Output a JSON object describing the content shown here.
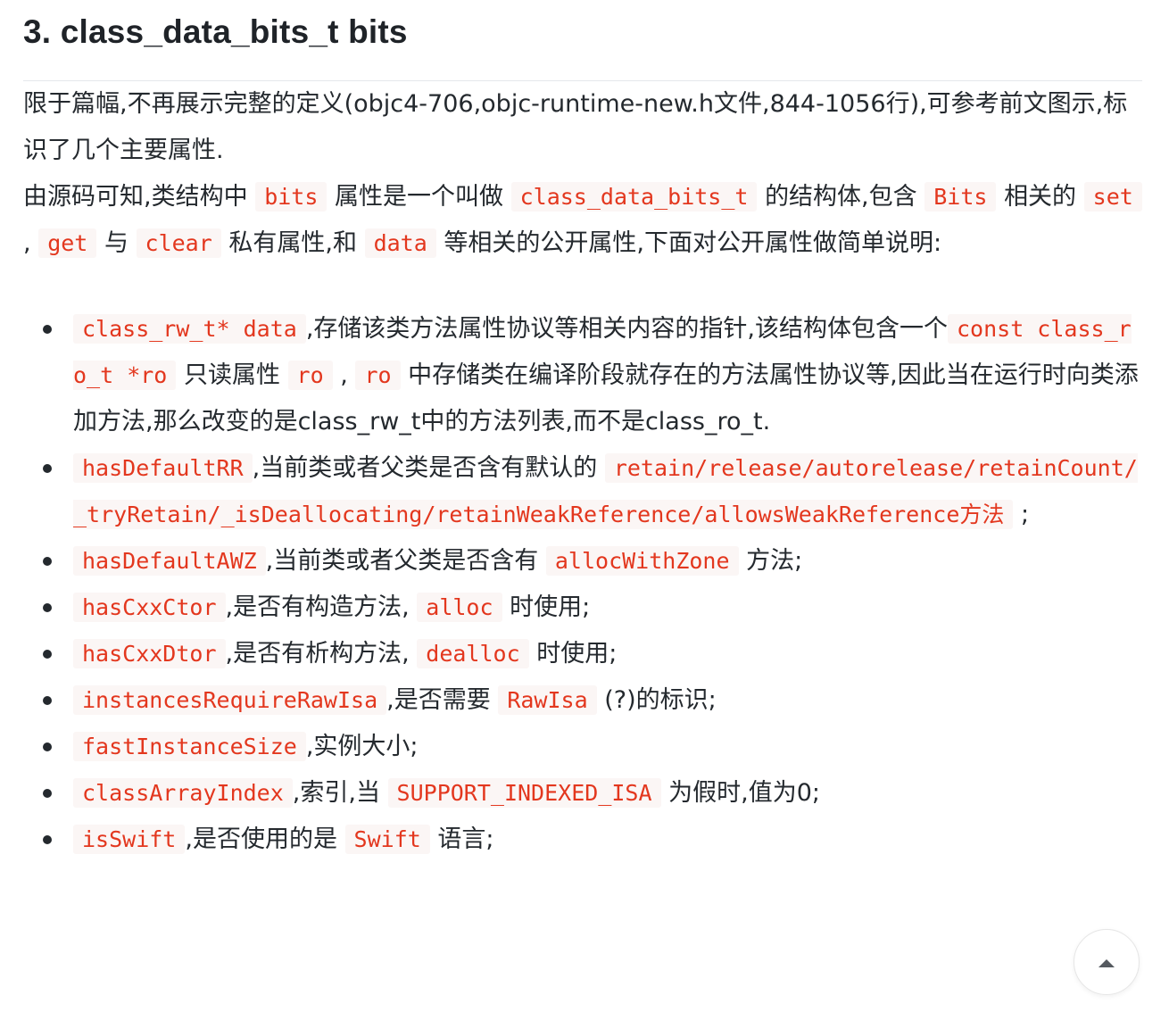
{
  "heading": "3. class_data_bits_t bits",
  "para1": "限于篇幅,不再展示完整的定义(objc4-706,objc-runtime-new.h文件,844-1056行),可参考前文图示,标识了几个主要属性.",
  "para2": {
    "t1": "由源码可知,类结构中",
    "c1": "bits",
    "t2": "属性是一个叫做",
    "c2": "class_data_bits_t",
    "t3": "的结构体,包含",
    "c3": "Bits",
    "t4": "相关的",
    "c4": "set",
    "t5": ",",
    "c5": "get",
    "t6": "与",
    "c6": "clear",
    "t7": "私有属性,和",
    "c7": "data",
    "t8": "等相关的公开属性,下面对公开属性做简单说明:"
  },
  "items": [
    {
      "c1": "class_rw_t* data",
      "t1": ",存储该类方法属性协议等相关内容的指针,该结构体包含一个",
      "c2": "const class_ro_t *ro",
      "t2": "只读属性",
      "c3": "ro",
      "t3": ",",
      "c4": "ro",
      "t4": "中存储类在编译阶段就存在的方法属性协议等,因此当在运行时向类添加方法,那么改变的是class_rw_t中的方法列表,而不是class_ro_t."
    },
    {
      "c1": "hasDefaultRR",
      "t1": ",当前类或者父类是否含有默认的",
      "c2": "retain/release/autorelease/retainCount/_tryRetain/_isDeallocating/retainWeakReference/allowsWeakReference方法",
      "t2": ";"
    },
    {
      "c1": "hasDefaultAWZ",
      "t1": ",当前类或者父类是否含有",
      "c2": "allocWithZone",
      "t2": "方法;"
    },
    {
      "c1": "hasCxxCtor",
      "t1": ",是否有构造方法,",
      "c2": "alloc",
      "t2": "时使用;"
    },
    {
      "c1": "hasCxxDtor",
      "t1": ",是否有析构方法,",
      "c2": "dealloc",
      "t2": "时使用;"
    },
    {
      "c1": "instancesRequireRawIsa",
      "t1": ",是否需要",
      "c2": "RawIsa",
      "t2": "(?)的标识;"
    },
    {
      "c1": "fastInstanceSize",
      "t1": ",实例大小;"
    },
    {
      "c1": "classArrayIndex",
      "t1": ",索引,当",
      "c2": "SUPPORT_INDEXED_ISA",
      "t2": "为假时,值为0;"
    },
    {
      "c1": "isSwift",
      "t1": ",是否使用的是",
      "c2": "Swift",
      "t2": "语言;"
    }
  ],
  "back_to_top_icon": "chevron-up-icon",
  "colors": {
    "inline_code_text": "#e3371e",
    "inline_code_bg": "#fbf6f5",
    "body_text": "#24292e",
    "divider": "#e5e7eb"
  }
}
